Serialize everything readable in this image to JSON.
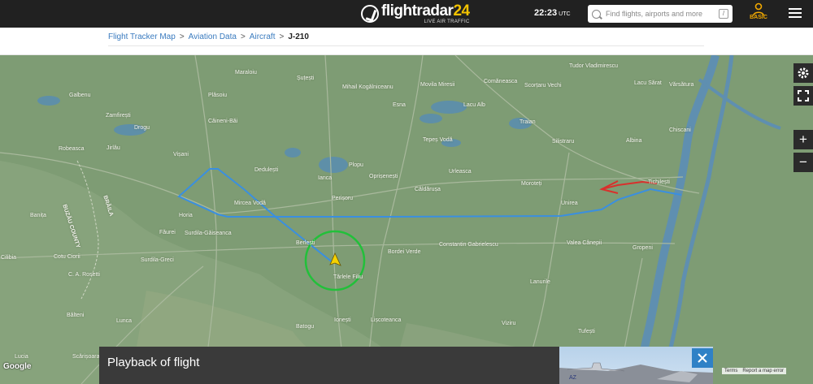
{
  "header": {
    "logo_main": "flightradar",
    "logo_num": "24",
    "logo_sub": "LIVE AIR TRAFFIC",
    "time": "22:23",
    "timezone": "UTC",
    "search_placeholder": "Find flights, airports and more",
    "search_shortcut": "/",
    "plan_label": "BASIC"
  },
  "breadcrumb": [
    {
      "label": "Flight Tracker Map",
      "link": true
    },
    {
      "label": "Aviation Data",
      "link": true
    },
    {
      "label": "Aircraft",
      "link": true
    },
    {
      "label": "J-210",
      "link": false
    }
  ],
  "breadcrumb_separator": ">",
  "map": {
    "labels": [
      "Maraloiu",
      "Șuțești",
      "Mihail Kogălniceanu",
      "Movila Miresii",
      "Comăneasca",
      "Scorțaru Vechi",
      "Tudor Vladimirescu",
      "Lacu Sărat",
      "Vărsătura",
      "Galbenu",
      "Plăsoiu",
      "Esna",
      "Lacu Alb",
      "Zamfirești",
      "Drogu",
      "Căineni-Băi",
      "Traian",
      "Chiscani",
      "Robeasca",
      "Jirlău",
      "Vișani",
      "Tepeș Vodă",
      "Silistraru",
      "Albina",
      "Dedulești",
      "Plopu",
      "Ianca",
      "Oprișenești",
      "Urleasca",
      "BUZĂU COUNTY",
      "BRĂILA",
      "Mircea Vodă",
      "Perișoru",
      "Căldărușa",
      "Moroteți",
      "Unirea",
      "Tichilești",
      "Banița",
      "Horia",
      "Făurei",
      "Surdila-Găiseanca",
      "Berlești",
      "Bordei Verde",
      "Constantin Gabrielescu",
      "Valea Cânepii",
      "Gropeni",
      "Cilibia",
      "Cotu Ciorii",
      "Surdila-Greci",
      "C. A. Rosetti",
      "Tărlele Filiu",
      "Lanurile",
      "Bălteni",
      "Lunca",
      "Batogu",
      "Ionești",
      "Lișcoteanca",
      "Viziru",
      "Tufești",
      "Lucia",
      "Scărișoara"
    ],
    "road_badges": [
      "220",
      "203A",
      "221",
      "22",
      "202E",
      "203",
      "221B",
      "23",
      "25",
      "211",
      "2B",
      "212",
      "2B",
      "203K",
      "255A",
      "21",
      "22",
      "203",
      "211",
      "221",
      "212",
      "2B",
      "203L",
      "203E",
      "2B",
      "204A",
      "211A",
      "211",
      "21",
      "203"
    ],
    "google_label": "Google",
    "attribution": [
      "Terms",
      "Report a map error"
    ]
  },
  "controls": {
    "settings_icon": "gear-icon",
    "fullscreen_icon": "fullscreen-icon",
    "zoom_in": "+",
    "zoom_out": "−"
  },
  "playback": {
    "title": "Playback of flight",
    "close_icon": "close-icon"
  },
  "colors": {
    "topbar": "#212121",
    "accent": "#f2c200",
    "link": "#3a7bbf",
    "track_blue": "#3a8fe0",
    "track_red": "#d9302c",
    "highlight_circle": "#22c03a",
    "aircraft": "#f5d200",
    "close_button": "#2f81c6"
  }
}
